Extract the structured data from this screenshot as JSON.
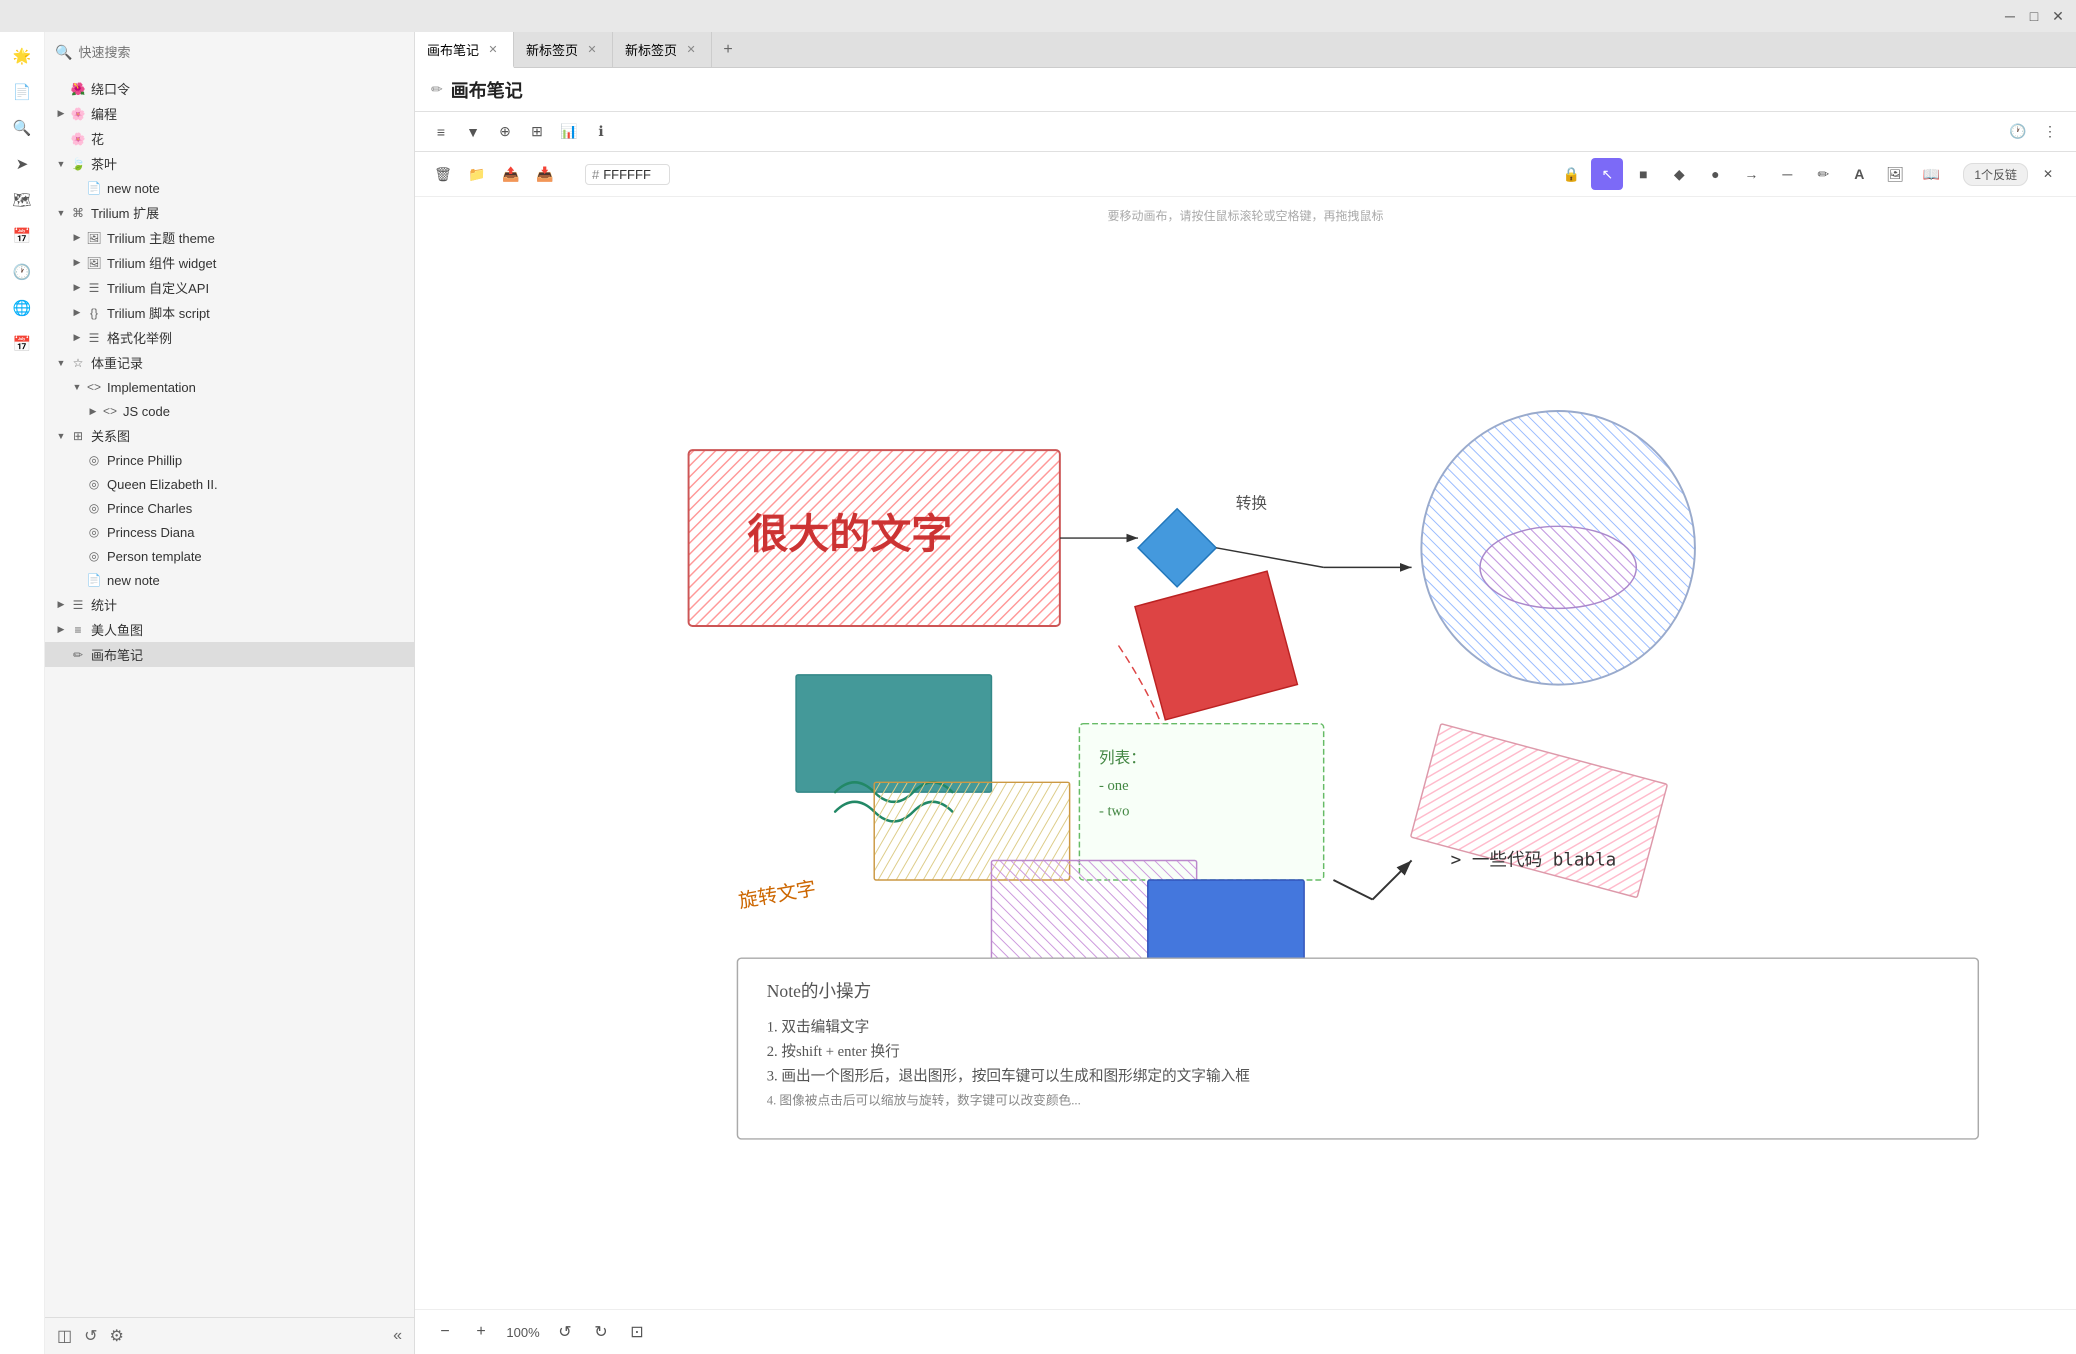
{
  "titleBar": {
    "minimizeLabel": "─",
    "maximizeLabel": "□",
    "closeLabel": "✕"
  },
  "sidebar": {
    "searchPlaceholder": "快速搜索",
    "items": [
      {
        "id": "rao",
        "label": "绕口令",
        "depth": 1,
        "icon": "🌺",
        "toggle": "",
        "hasToggle": false
      },
      {
        "id": "bian",
        "label": "编程",
        "depth": 1,
        "icon": "🌸",
        "toggle": "▶",
        "hasToggle": true
      },
      {
        "id": "hua",
        "label": "花",
        "depth": 1,
        "icon": "🌸",
        "toggle": "",
        "hasToggle": false
      },
      {
        "id": "cha",
        "label": "茶叶",
        "depth": 1,
        "icon": "🍃",
        "toggle": "▼",
        "hasToggle": true,
        "expanded": true
      },
      {
        "id": "new1",
        "label": "new note",
        "depth": 2,
        "icon": "📄",
        "toggle": "",
        "hasToggle": false
      },
      {
        "id": "trilium-ext",
        "label": "Trilium 扩展",
        "depth": 1,
        "icon": "⌘",
        "toggle": "▼",
        "hasToggle": true,
        "expanded": true
      },
      {
        "id": "trilium-theme",
        "label": "Trilium 主题 theme",
        "depth": 2,
        "icon": "🖼",
        "toggle": "▶",
        "hasToggle": true
      },
      {
        "id": "trilium-widget",
        "label": "Trilium 组件 widget",
        "depth": 2,
        "icon": "🖼",
        "toggle": "▶",
        "hasToggle": true
      },
      {
        "id": "trilium-api",
        "label": "Trilium 自定义API",
        "depth": 2,
        "icon": "☰",
        "toggle": "▶",
        "hasToggle": true
      },
      {
        "id": "trilium-script",
        "label": "Trilium 脚本 script",
        "depth": 2,
        "icon": "{}",
        "toggle": "▶",
        "hasToggle": true
      },
      {
        "id": "format",
        "label": "格式化举例",
        "depth": 2,
        "icon": "☰",
        "toggle": "▶",
        "hasToggle": true
      },
      {
        "id": "weight",
        "label": "体重记录",
        "depth": 1,
        "icon": "☆",
        "toggle": "▼",
        "hasToggle": true,
        "expanded": true
      },
      {
        "id": "impl",
        "label": "Implementation",
        "depth": 2,
        "icon": "<>",
        "toggle": "▼",
        "hasToggle": true,
        "expanded": true
      },
      {
        "id": "jscode",
        "label": "JS code",
        "depth": 3,
        "icon": "<>",
        "toggle": "▶",
        "hasToggle": true
      },
      {
        "id": "relation",
        "label": "关系图",
        "depth": 1,
        "icon": "⊞",
        "toggle": "▼",
        "hasToggle": true,
        "expanded": true
      },
      {
        "id": "prince-phillip",
        "label": "Prince Phillip",
        "depth": 2,
        "icon": "◎",
        "toggle": "",
        "hasToggle": false
      },
      {
        "id": "queen-elizabeth",
        "label": "Queen Elizabeth II.",
        "depth": 2,
        "icon": "◎",
        "toggle": "",
        "hasToggle": false
      },
      {
        "id": "prince-charles",
        "label": "Prince Charles",
        "depth": 2,
        "icon": "◎",
        "toggle": "",
        "hasToggle": false
      },
      {
        "id": "princess-diana",
        "label": "Princess Diana",
        "depth": 2,
        "icon": "◎",
        "toggle": "",
        "hasToggle": false
      },
      {
        "id": "person-template",
        "label": "Person template",
        "depth": 2,
        "icon": "◎",
        "toggle": "",
        "hasToggle": false
      },
      {
        "id": "new2",
        "label": "new note",
        "depth": 2,
        "icon": "📄",
        "toggle": "",
        "hasToggle": false
      },
      {
        "id": "stats",
        "label": "统计",
        "depth": 1,
        "icon": "☰",
        "toggle": "▶",
        "hasToggle": true
      },
      {
        "id": "mermaid",
        "label": "美人鱼图",
        "depth": 1,
        "icon": "≡",
        "toggle": "▶",
        "hasToggle": true
      },
      {
        "id": "canvas",
        "label": "画布笔记",
        "depth": 1,
        "icon": "✏",
        "toggle": "",
        "hasToggle": false,
        "active": true
      }
    ],
    "footer": {
      "layersIcon": "◫",
      "refreshIcon": "↺",
      "settingsIcon": "⚙",
      "collapseLabel": "«"
    }
  },
  "tabs": [
    {
      "label": "画布笔记",
      "active": true,
      "closable": true
    },
    {
      "label": "新标签页",
      "active": false,
      "closable": true
    },
    {
      "label": "新标签页",
      "active": false,
      "closable": true
    }
  ],
  "note": {
    "title": "画布笔记",
    "editIcon": "✏"
  },
  "toolbar": {
    "items": [
      {
        "icon": "≡",
        "label": "menu"
      },
      {
        "icon": "▼",
        "label": "down-arrow"
      },
      {
        "icon": "⊕",
        "label": "add"
      },
      {
        "icon": "⊞",
        "label": "grid"
      },
      {
        "icon": "📊",
        "label": "chart"
      },
      {
        "icon": "ℹ",
        "label": "info"
      },
      {
        "icon": "🕐",
        "label": "history"
      },
      {
        "icon": "⋮",
        "label": "more"
      }
    ]
  },
  "canvasToolbar": {
    "left": [
      {
        "icon": "🗑",
        "label": "delete"
      },
      {
        "icon": "📁",
        "label": "folder"
      },
      {
        "icon": "📤",
        "label": "export-note"
      },
      {
        "icon": "📥",
        "label": "import-note"
      }
    ],
    "colorInput": {
      "hash": "#",
      "value": "FFFFFF"
    },
    "right": [
      {
        "icon": "🔒",
        "label": "lock"
      },
      {
        "icon": "↖",
        "label": "cursor",
        "active": true
      },
      {
        "icon": "■",
        "label": "rectangle"
      },
      {
        "icon": "◆",
        "label": "diamond"
      },
      {
        "icon": "●",
        "label": "circle"
      },
      {
        "icon": "→",
        "label": "arrow"
      },
      {
        "icon": "─",
        "label": "line"
      },
      {
        "icon": "✏",
        "label": "pencil"
      },
      {
        "icon": "A",
        "label": "text"
      },
      {
        "icon": "🖼",
        "label": "image"
      },
      {
        "icon": "📖",
        "label": "embed"
      }
    ],
    "backlinkBadge": "1个反链",
    "closeIcon": "✕"
  },
  "canvasHint": "要移动画布，请按住鼠标滚轮或空格键，再拖拽鼠标",
  "canvasContent": {
    "shapes": [
      {
        "type": "rect",
        "label": "big-text-box"
      },
      {
        "type": "diamond",
        "label": "diamond-shape"
      },
      {
        "type": "circle",
        "label": "circle-shape"
      },
      {
        "type": "rect-red",
        "label": "red-diamond"
      },
      {
        "type": "rect-teal",
        "label": "teal-rect"
      },
      {
        "type": "rect-yellow",
        "label": "yellow-rect"
      },
      {
        "type": "rect-pink",
        "label": "pink-rect"
      },
      {
        "type": "rect-purple",
        "label": "purple-rect"
      },
      {
        "type": "rect-blue",
        "label": "blue-rect"
      },
      {
        "type": "note-box",
        "label": "note-box"
      }
    ],
    "texts": [
      {
        "content": "很大的文字",
        "label": "big-text"
      },
      {
        "content": "转换",
        "label": "transform-text"
      },
      {
        "content": "旋转文字",
        "label": "rotate-text"
      },
      {
        "content": "> 一些代码 blabla",
        "label": "code-text"
      },
      {
        "content": "列表：\n- one\n- two",
        "label": "list-text"
      }
    ],
    "noteContent": {
      "title": "Note的小操方",
      "lines": [
        "1. 双击编辑文字",
        "2. 按shift + enter 换行",
        "3. 画出一个图形后，退出图形，按回车键可以生成和图形绑定的文字输入框"
      ]
    }
  },
  "canvasBottom": {
    "zoomOut": "−",
    "zoomIn": "+",
    "zoomLevel": "100%",
    "undo": "↺",
    "redo": "↻",
    "fit": "⊡"
  },
  "leftSidebarIcons": [
    {
      "icon": "📋",
      "label": "notes"
    },
    {
      "icon": "🔍",
      "label": "search"
    },
    {
      "icon": "⊹",
      "label": "add-note"
    },
    {
      "icon": "📅",
      "label": "calendar"
    },
    {
      "icon": "🕐",
      "label": "recent"
    },
    {
      "icon": "🌐",
      "label": "global"
    },
    {
      "icon": "📅",
      "label": "calendar2"
    }
  ]
}
